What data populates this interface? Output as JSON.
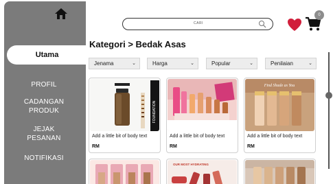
{
  "sidebar": {
    "active": "Utama",
    "items": [
      "PROFIL",
      "CADANGAN\nPRODUK",
      "JEJAK\nPESANAN",
      "NOTIFIKASI"
    ]
  },
  "search": {
    "placeholder": "CARI"
  },
  "cart": {
    "count": "0"
  },
  "page": {
    "title": "Kategori > Bedak Asas"
  },
  "filters": [
    "Jenama",
    "Harga",
    "Popular",
    "Penilaian"
  ],
  "products": [
    {
      "desc": "Add a little bit of body text",
      "price": "RM",
      "image_text": "FOUNDATION"
    },
    {
      "desc": "Add a little bit of body text",
      "price": "RM"
    },
    {
      "desc": "Add a little bit of body text",
      "price": "RM",
      "image_text": "Find Shade as You"
    }
  ],
  "products_row2": [
    {
      "image_text": ""
    },
    {
      "image_text": "OUR MOST HYDRATING"
    },
    {
      "image_text": ""
    }
  ],
  "colors": {
    "sidebar": "#7b7b7b",
    "heart": "#d11f3b",
    "accent": "#111111"
  }
}
